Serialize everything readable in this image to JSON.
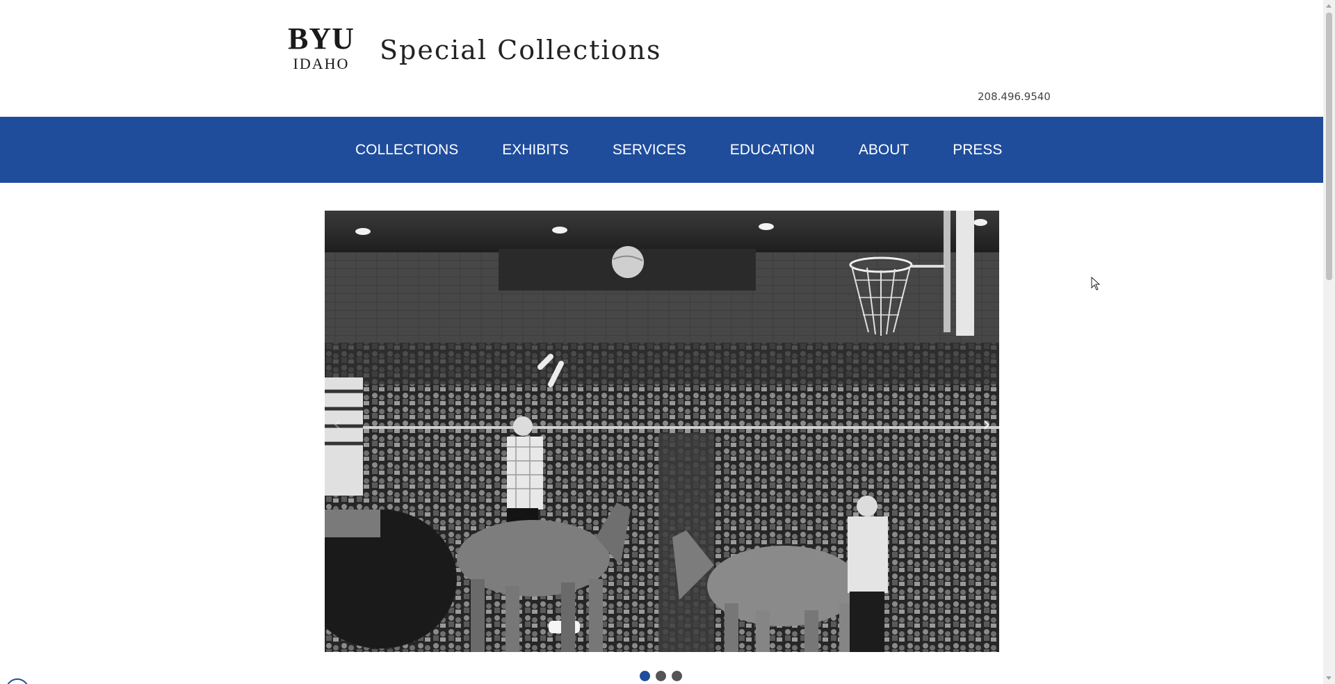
{
  "header": {
    "logo_top": "BYU",
    "logo_bottom": "IDAHO",
    "site_title": "Special Collections",
    "phone": "208.496.9540"
  },
  "nav": {
    "items": [
      {
        "label": "COLLECTIONS"
      },
      {
        "label": "EXHIBITS"
      },
      {
        "label": "SERVICES"
      },
      {
        "label": "EDUCATION"
      },
      {
        "label": "ABOUT"
      },
      {
        "label": "PRESS"
      }
    ]
  },
  "carousel": {
    "prev_glyph": "‹",
    "next_glyph": "›",
    "slide_count": 3,
    "active_slide": 1,
    "image_description_icon": "photo-basketball-donkeys"
  },
  "colors": {
    "brand_blue": "#1f4d9c",
    "dot_inactive": "#555555"
  }
}
